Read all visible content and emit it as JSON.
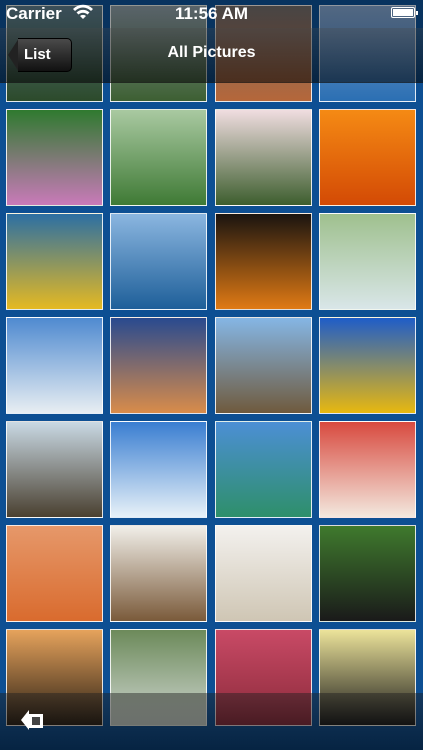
{
  "status_bar": {
    "carrier": "Carrier",
    "time": "11:56 AM"
  },
  "nav": {
    "back_label": "List",
    "title": "All Pictures"
  },
  "toolbar": {
    "slideshow_icon": "slideshow-icon"
  },
  "photos": [
    {
      "name": "misty-mountain-thumbnail",
      "c1": "#5b7a8a",
      "c2": "#2c4a2b"
    },
    {
      "name": "forest-clearing-thumbnail",
      "c1": "#8a9aa3",
      "c2": "#3d5f32"
    },
    {
      "name": "red-canyon-thumbnail",
      "c1": "#6f6a6a",
      "c2": "#b5673a"
    },
    {
      "name": "blue-dock-thumbnail",
      "c1": "#7fa0c9",
      "c2": "#2b6fb3"
    },
    {
      "name": "pink-flowers-thumbnail",
      "c1": "#2f7a2f",
      "c2": "#c97ab9"
    },
    {
      "name": "forest-path-thumbnail",
      "c1": "#a9c9a1",
      "c2": "#3f7a35"
    },
    {
      "name": "white-lilies-thumbnail",
      "c1": "#f0dde0",
      "c2": "#3d5e2e"
    },
    {
      "name": "orange-flowers-thumbnail",
      "c1": "#f58a14",
      "c2": "#d34a05"
    },
    {
      "name": "sea-turtle-thumbnail",
      "c1": "#2c6fa3",
      "c2": "#e5b922"
    },
    {
      "name": "whale-tail-thumbnail",
      "c1": "#8bb6e0",
      "c2": "#1e5f99"
    },
    {
      "name": "tokyo-tower-thumbnail",
      "c1": "#1a1410",
      "c2": "#e07a14"
    },
    {
      "name": "waterfall-stream-thumbnail",
      "c1": "#9fc08e",
      "c2": "#d9e6e8"
    },
    {
      "name": "cloudy-mountains-thumbnail",
      "c1": "#4f8ad0",
      "c2": "#e8eef2"
    },
    {
      "name": "palm-tree-sunset-thumbnail",
      "c1": "#294a8f",
      "c2": "#d98c4a"
    },
    {
      "name": "railway-tracks-thumbnail",
      "c1": "#85b6e5",
      "c2": "#6f5a3d"
    },
    {
      "name": "sunflower-thumbnail",
      "c1": "#1f5dc8",
      "c2": "#e8b80f"
    },
    {
      "name": "window-cats-thumbnail",
      "c1": "#c9d9e4",
      "c2": "#4a4030"
    },
    {
      "name": "sky-clouds-thumbnail",
      "c1": "#3a7ed1",
      "c2": "#e7f1f8"
    },
    {
      "name": "beach-horizon-thumbnail",
      "c1": "#4c8fd5",
      "c2": "#2e8f6a"
    },
    {
      "name": "birthday-cake-thumbnail",
      "c1": "#d84a3f",
      "c2": "#f3e8de"
    },
    {
      "name": "desert-oryx-thumbnail",
      "c1": "#e6986a",
      "c2": "#d96b2e"
    },
    {
      "name": "smooth-rock-thumbnail",
      "c1": "#f1efe9",
      "c2": "#7a5a3a"
    },
    {
      "name": "seashell-thumbnail",
      "c1": "#f3f1ee",
      "c2": "#cfc6b4"
    },
    {
      "name": "toucan-thumbnail",
      "c1": "#3f7a2d",
      "c2": "#1a1a1a"
    },
    {
      "name": "tree-silhouette-thumbnail",
      "c1": "#e6a35c",
      "c2": "#2a1f14"
    },
    {
      "name": "rocky-falls-thumbnail",
      "c1": "#6c8a5a",
      "c2": "#cfd6d0"
    },
    {
      "name": "pink-succulents-thumbnail",
      "c1": "#c94a66",
      "c2": "#8a2a3a"
    },
    {
      "name": "glass-floor-thumbnail",
      "c1": "#ece39a",
      "c2": "#1a1a1a"
    }
  ]
}
